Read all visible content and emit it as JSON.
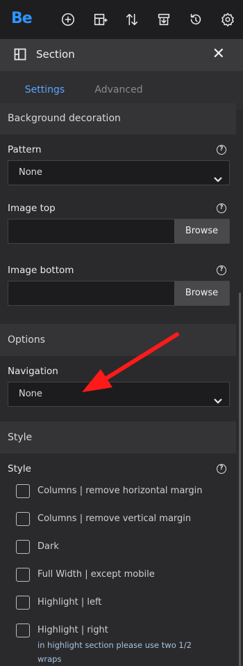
{
  "toolbar": {
    "logo": "Be",
    "icons": [
      "add-icon",
      "layout-add-icon",
      "sort-icon",
      "export-icon",
      "history-icon",
      "settings-icon"
    ]
  },
  "panel": {
    "title": "Section",
    "close": "✕",
    "tabs": [
      "Settings",
      "Advanced"
    ]
  },
  "background": {
    "group_title": "Background decoration",
    "pattern_label": "Pattern",
    "pattern_value": "None",
    "image_top_label": "Image top",
    "image_bottom_label": "Image bottom",
    "browse_label": "Browse"
  },
  "options": {
    "group_title": "Options",
    "navigation_label": "Navigation",
    "navigation_value": "None"
  },
  "style": {
    "group_title": "Style",
    "field_label": "Style",
    "checkboxes": [
      "Columns | remove horizontal margin",
      "Columns | remove vertical margin",
      "Dark",
      "Full Width | except mobile",
      "Highlight | left",
      "Highlight | right"
    ],
    "hint_line1": "in highlight section please use two 1/2",
    "hint_line2": "wraps"
  },
  "help_glyph": "?",
  "colors": {
    "accent": "#5ca4ff",
    "logo": "#2f93ff",
    "arrow": "#ff1a1a"
  }
}
